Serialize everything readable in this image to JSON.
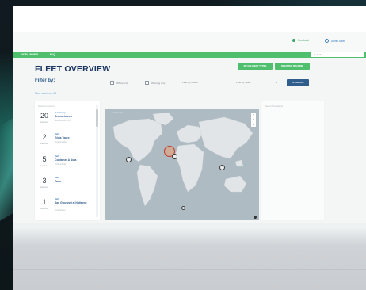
{
  "header": {
    "feedback": "Feedback",
    "user": "Admin Arsen"
  },
  "nav": {
    "items": [
      "MY PLANNING",
      "FAQ"
    ],
    "search_placeholder": "Search..."
  },
  "page": {
    "title": "FLEET OVERVIEW",
    "btn_delivery": "MY DELIVERY TYPES",
    "btn_register": "REGISTER MACHINE",
    "filter_by": "Filter by:",
    "fleet_count": "Fleet machines: 63",
    "offline_only": "Offline only",
    "warning_only": "Warning only",
    "filter_by_model": "Filter by Model",
    "filter_by_state": "Filter by State",
    "clear_all": "CLEAR ALL"
  },
  "list": {
    "search_placeholder": "Search locations",
    "items": [
      {
        "count": "20",
        "count_label": "machines",
        "country": "Germany",
        "port": "Bremerhaven",
        "sub": "Bremerhaven Port"
      },
      {
        "count": "2",
        "count_label": "machines",
        "country": "Italy",
        "port": "Gioia Tauro",
        "sub": "Porto di Gioia"
      },
      {
        "count": "5",
        "count_label": "machines",
        "country": "Italy",
        "port": "Container A Nota",
        "sub": "Porto di Nota"
      },
      {
        "count": "3",
        "count_label": "machines",
        "country": "Italy",
        "port": "Turin",
        "sub": ""
      },
      {
        "count": "1",
        "count_label": "machines",
        "country": "Italy",
        "port": "San Giovanni al Natisone",
        "sub": "Porto Nuovo"
      }
    ]
  },
  "map": {
    "search_placeholder": "Search map",
    "zoom_in": "+",
    "zoom_out": "−",
    "reset": "⌂"
  },
  "detail": {
    "search_placeholder": "Search locations"
  },
  "colors": {
    "brand_green": "#4fbf6e",
    "title_navy": "#1b3561",
    "button_blue": "#2f5d8c",
    "map_water": "#aebbc3",
    "map_land": "#e2e5e7"
  }
}
